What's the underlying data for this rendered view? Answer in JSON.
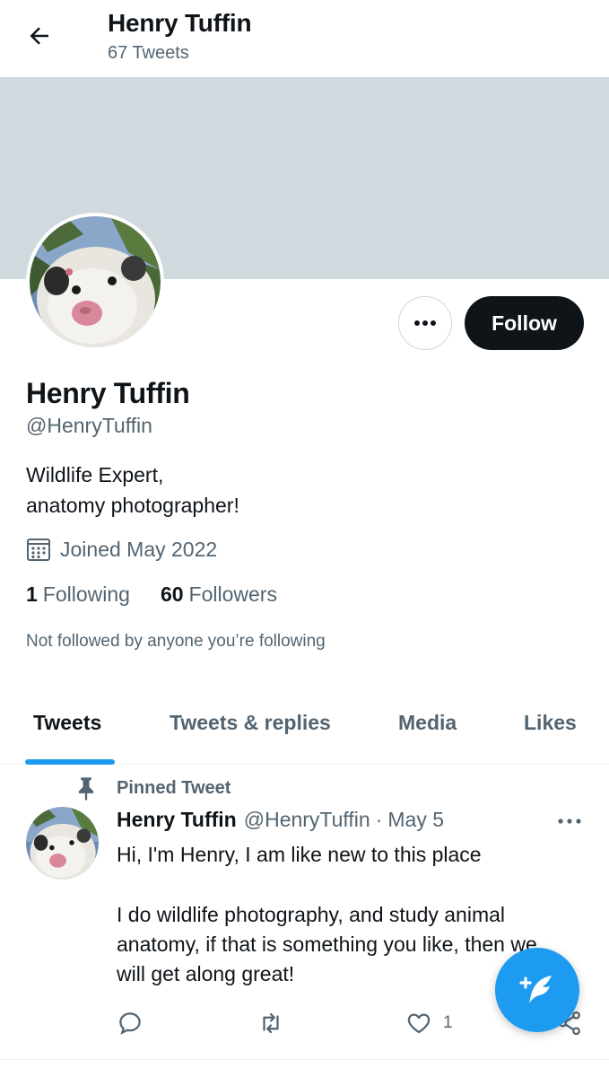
{
  "header": {
    "name": "Henry Tuffin",
    "tweet_count": "67 Tweets",
    "back_icon": "arrow-left-icon"
  },
  "profile": {
    "banner_color": "#cfd9de",
    "display_name": "Henry Tuffin",
    "handle": "@HenryTuffin",
    "bio_lines": [
      "Wildlife Expert,",
      "anatomy photographer!"
    ],
    "joined": "Joined May 2022",
    "following_count": "1",
    "following_label": "Following",
    "followers_count": "60",
    "followers_label": "Followers",
    "not_followed": "Not followed by anyone you’re following",
    "follow_button": "Follow",
    "more_icon": "more-dots-icon"
  },
  "tabs": [
    {
      "label": "Tweets",
      "active": true
    },
    {
      "label": "Tweets & replies",
      "active": false
    },
    {
      "label": "Media",
      "active": false
    },
    {
      "label": "Likes",
      "active": false
    }
  ],
  "tweet": {
    "pinned_label": "Pinned Tweet",
    "author_name": "Henry Tuffin",
    "author_handle": "@HenryTuffin",
    "separator": "·",
    "date": "May 5",
    "paragraphs": [
      "Hi,  I'm Henry,  I am like new to this place",
      "I do wildlife photography,  and study animal anatomy,  if that is something you like,  then we will get along great!"
    ],
    "actions": {
      "reply_icon": "reply-icon",
      "retweet_icon": "retweet-icon",
      "like_icon": "heart-icon",
      "like_count": "1",
      "share_icon": "share-icon"
    }
  },
  "fab": {
    "icon": "compose-tweet-icon"
  },
  "colors": {
    "accent": "#1d9bf0",
    "text_primary": "#0f1419",
    "text_secondary": "#536471",
    "border": "#cfd9de"
  }
}
